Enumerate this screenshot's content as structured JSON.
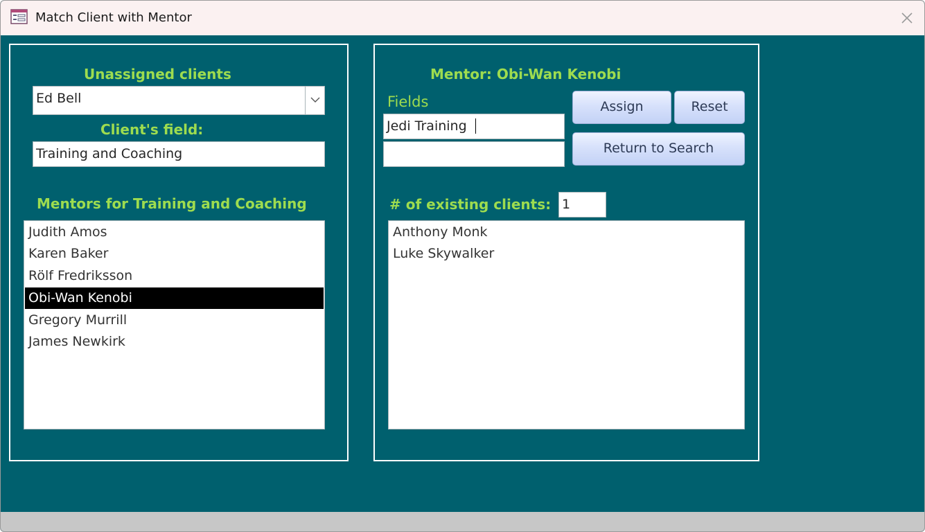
{
  "window": {
    "title": "Match Client with Mentor",
    "app_icon": "form-icon",
    "close_icon": "close-icon"
  },
  "left_panel": {
    "unassigned_label": "Unassigned clients",
    "unassigned_value": "Ed Bell",
    "clients_field_label": "Client's field:",
    "clients_field_value": "Training and Coaching",
    "mentors_label": "Mentors for Training and Coaching",
    "mentors": [
      {
        "name": "Judith Amos",
        "selected": false
      },
      {
        "name": "Karen Baker",
        "selected": false
      },
      {
        "name": "Rölf Fredriksson",
        "selected": false
      },
      {
        "name": "Obi-Wan Kenobi",
        "selected": true
      },
      {
        "name": "Gregory Murrill",
        "selected": false
      },
      {
        "name": "James Newkirk",
        "selected": false
      }
    ]
  },
  "right_panel": {
    "mentor_title": "Mentor: Obi-Wan Kenobi",
    "fields_label": "Fields",
    "field_1": "Jedi Training",
    "field_2": "",
    "assign_label": "Assign",
    "reset_label": "Reset",
    "return_label": "Return to Search",
    "existing_clients_label": "# of existing clients:",
    "existing_clients_count": "1",
    "existing_clients": [
      "Anthony Monk",
      "Luke Skywalker"
    ]
  },
  "colors": {
    "background": "#00606e",
    "label_green": "#9edc4f",
    "selected_bg": "#000000"
  }
}
